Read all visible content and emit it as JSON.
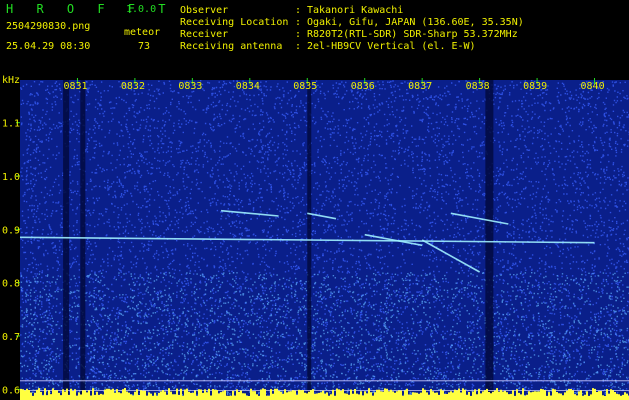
{
  "header": {
    "brand": "H R O F F T",
    "version": "1.0.0",
    "filename": "2504290830.png",
    "mode_label": "meteor",
    "datetime": "25.04.29 08:30",
    "count": "73",
    "info_labels": [
      "Observer",
      "Receiving Location",
      "Receiver",
      "Receiving antenna"
    ],
    "info_colons": [
      ":",
      ":",
      ":",
      ":"
    ],
    "info_values": [
      "Takanori Kawachi",
      "Ogaki, Gifu, JAPAN (136.60E, 35.35N)",
      "R820T2(RTL-SDR) SDR-Sharp 53.372MHz",
      "2el-HB9CV Vertical (el. E-W)"
    ]
  },
  "chart_data": {
    "type": "heatmap",
    "ylabel": "kHz",
    "y_ticks": [
      "1.1",
      "1.0",
      "0.9",
      "0.8",
      "0.7",
      "0.6"
    ],
    "y_tick_values": [
      1.1,
      1.0,
      0.9,
      0.8,
      0.7,
      0.6
    ],
    "x_ticks": [
      "0831",
      "0832",
      "0833",
      "0834",
      "0835",
      "0836",
      "0837",
      "0838",
      "0839",
      "0840"
    ],
    "ylim": [
      0.58,
      1.18
    ],
    "background_color": "#0a1f8a",
    "noise_color": "#3a60ff",
    "signal_color": "#ffff40",
    "trails": [
      {
        "x_start": "0830",
        "x_end": "0840",
        "y": [
          0.885,
          0.875
        ]
      },
      {
        "x_start": "0833.5",
        "x_end": "0834.5",
        "y": [
          0.935,
          0.925
        ]
      },
      {
        "x_start": "0835",
        "x_end": "0835.5",
        "y": [
          0.93,
          0.92
        ]
      },
      {
        "x_start": "0836",
        "x_end": "0837",
        "y": [
          0.89,
          0.87
        ]
      },
      {
        "x_start": "0837",
        "x_end": "0838",
        "y": [
          0.88,
          0.82
        ]
      },
      {
        "x_start": "0837.5",
        "x_end": "0838.5",
        "y": [
          0.93,
          0.91
        ]
      }
    ]
  }
}
